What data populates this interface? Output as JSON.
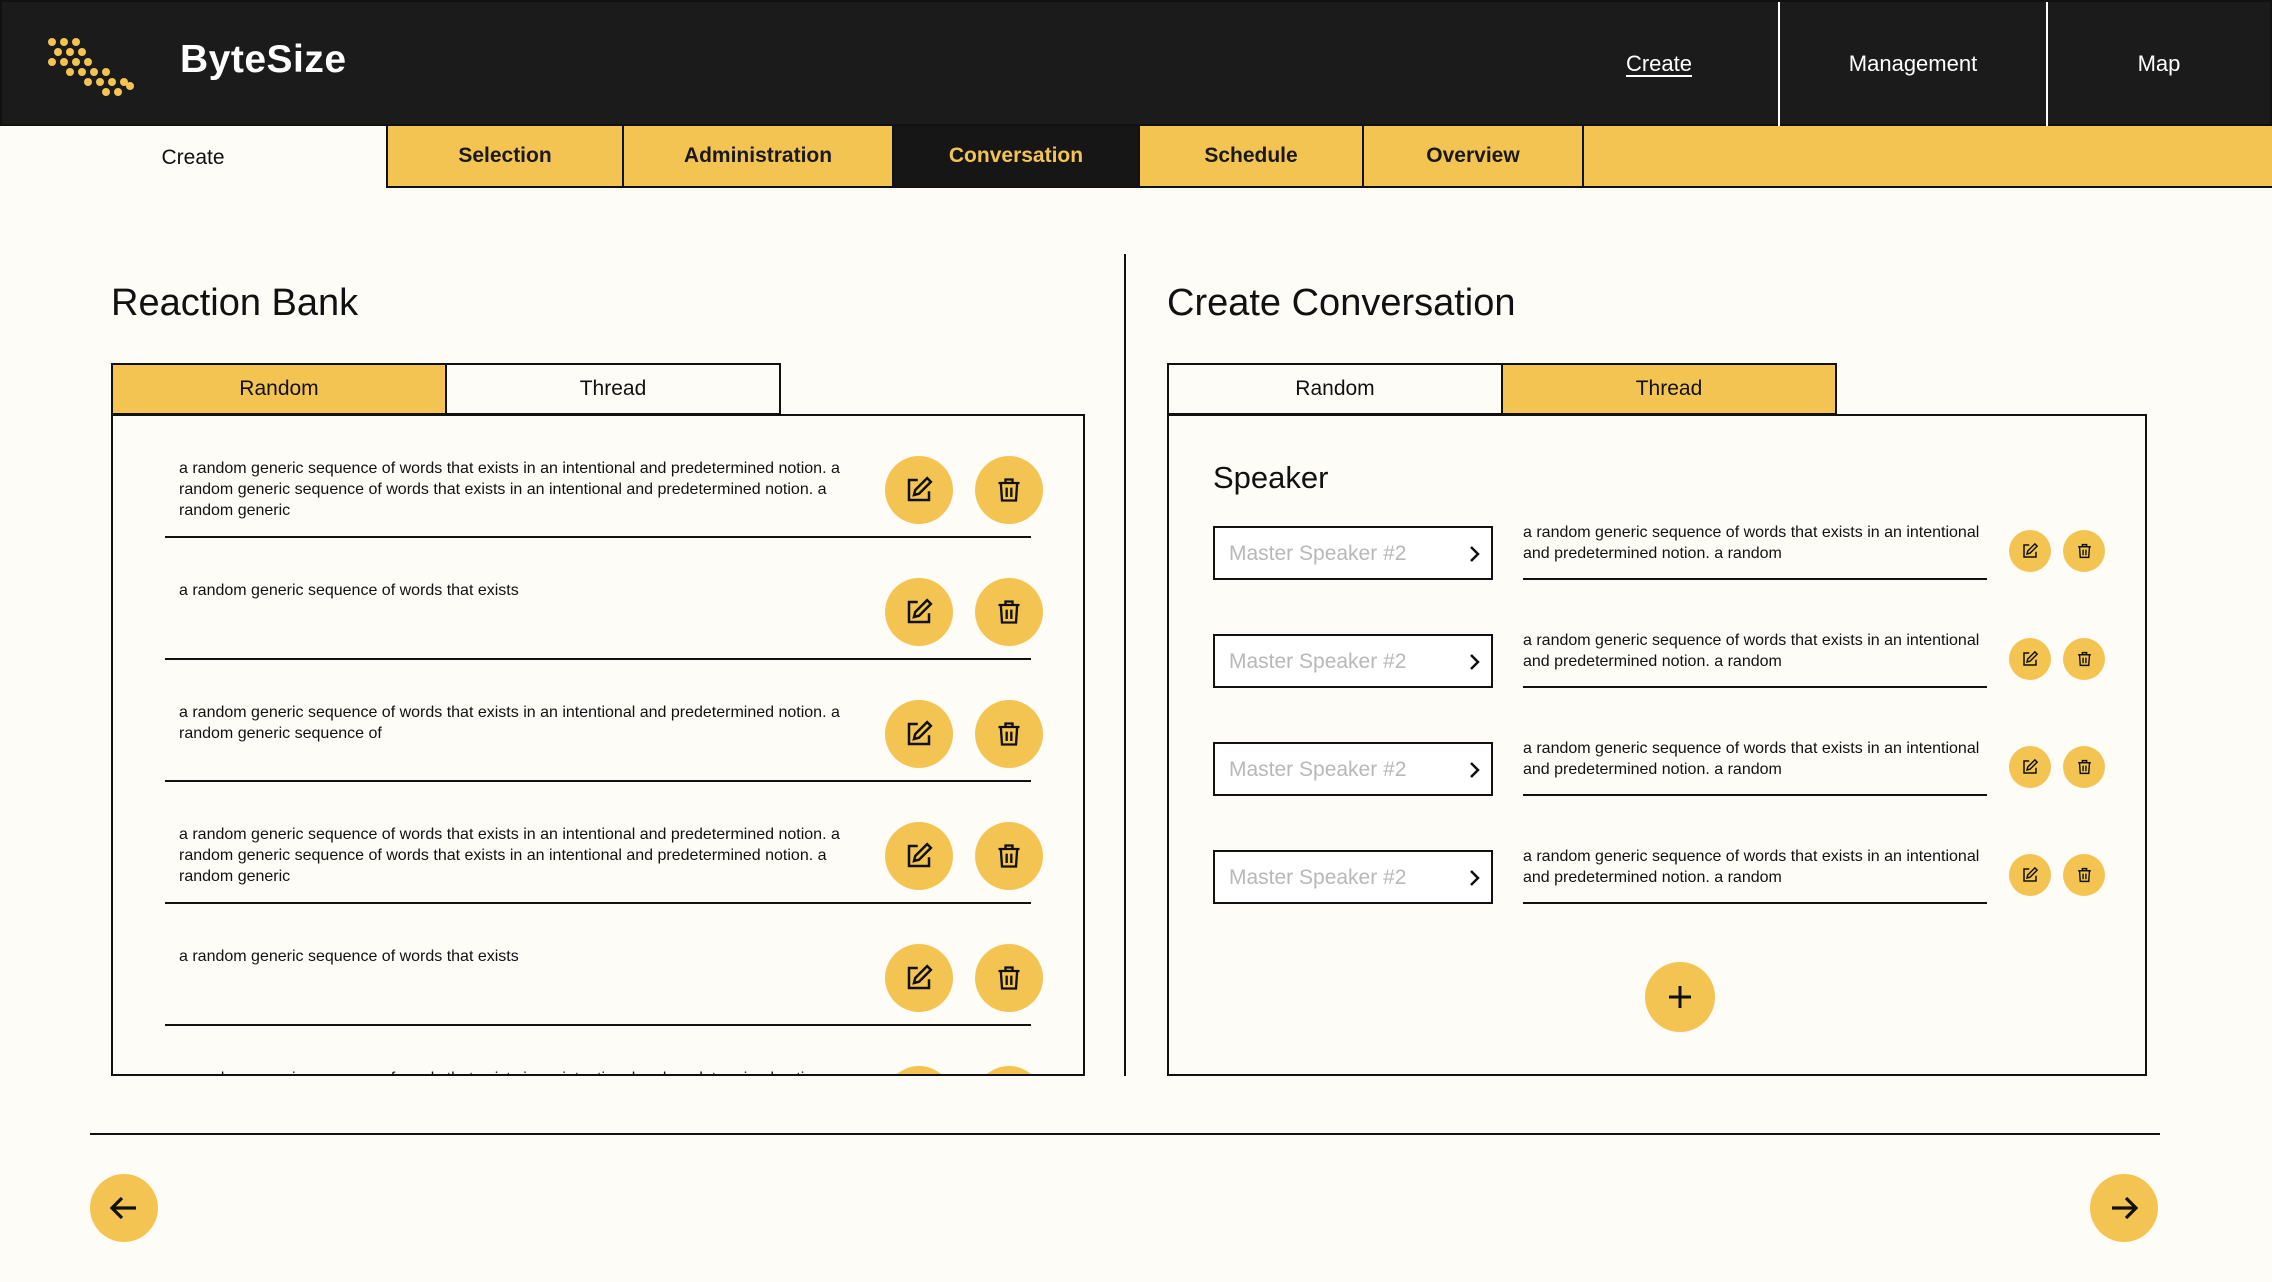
{
  "app": {
    "brand": "ByteSize"
  },
  "topnav": {
    "create": "Create",
    "management": "Management",
    "map": "Map"
  },
  "subnav": {
    "current": "Create",
    "tabs": [
      "Selection",
      "Administration",
      "Conversation",
      "Schedule",
      "Overview"
    ],
    "active_tab": "Conversation"
  },
  "reaction_bank": {
    "title": "Reaction Bank",
    "segments": [
      "Random",
      "Thread"
    ],
    "selected_segment": "Random",
    "items": [
      "a random generic sequence of words that exists in an intentional and predetermined notion.  a random generic sequence of words that exists in an intentional and predetermined notion. a random generic",
      "a random generic sequence of words that exists",
      "a random generic sequence of words that exists in an intentional and predetermined notion.  a random generic sequence of",
      "a random generic sequence of words that exists in an intentional and predetermined notion.  a random generic sequence of words that exists in an intentional and predetermined notion. a random generic",
      "a random generic sequence of words that exists",
      "a random generic sequence of words that exists in an intentional and predetermined notion."
    ]
  },
  "create_conversation": {
    "title": "Create Conversation",
    "segments": [
      "Random",
      "Thread"
    ],
    "selected_segment": "Thread",
    "speaker_label": "Speaker",
    "rows": [
      {
        "speaker_placeholder": "Master Speaker #2",
        "text": "a random generic sequence of words that exists in an intentional and predetermined notion.  a random"
      },
      {
        "speaker_placeholder": "Master Speaker #2",
        "text": "a random generic sequence of words that exists in an intentional and predetermined notion.  a random"
      },
      {
        "speaker_placeholder": "Master Speaker #2",
        "text": "a random generic sequence of words that exists in an intentional and predetermined notion.  a random"
      },
      {
        "speaker_placeholder": "Master Speaker #2",
        "text": "a random generic sequence of words that exists in an intentional and predetermined notion.  a random"
      }
    ]
  },
  "icons": {
    "logo": "bytesize-dots-logo",
    "edit": "edit-icon",
    "delete": "trash-icon",
    "chevron": "chevron-right-icon",
    "add": "plus-icon",
    "prev": "arrow-left-icon",
    "next": "arrow-right-icon"
  },
  "colors": {
    "accent": "#f4c453",
    "dark": "#1b1b1b",
    "background": "#fdfcf7"
  }
}
